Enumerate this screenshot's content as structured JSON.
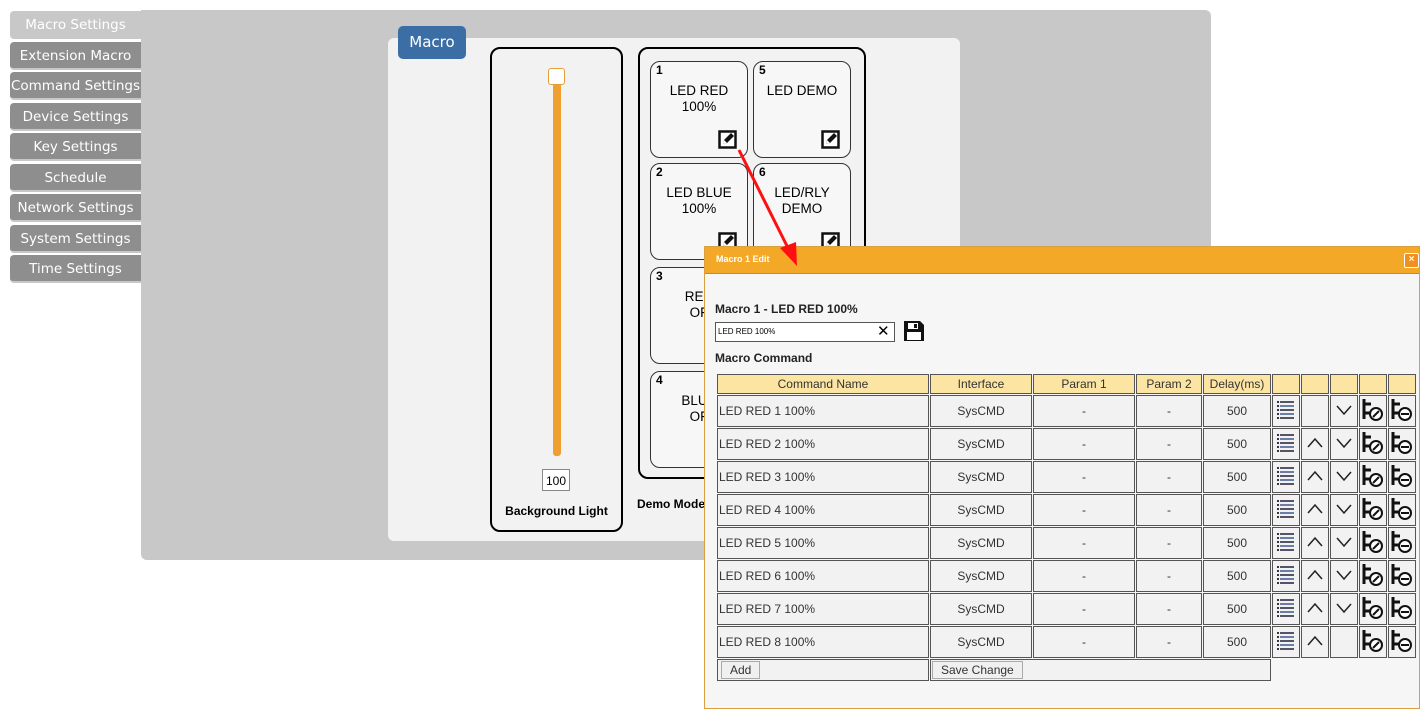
{
  "sidebar": {
    "items": [
      {
        "label": "Macro Settings",
        "active": true
      },
      {
        "label": "Extension Macro"
      },
      {
        "label": "Command Settings"
      },
      {
        "label": "Device Settings"
      },
      {
        "label": "Key Settings"
      },
      {
        "label": "Schedule"
      },
      {
        "label": "Network Settings"
      },
      {
        "label": "System Settings"
      },
      {
        "label": "Time Settings"
      }
    ]
  },
  "macro_panel": {
    "title": "Macro",
    "slider_value": "100",
    "slider_level_percent": 100,
    "bg_light_label": "Background Light",
    "demo_mode_label": "Demo Mode",
    "buttons": [
      {
        "num": "1",
        "label": "LED RED\n100%"
      },
      {
        "num": "5",
        "label": "LED DEMO"
      },
      {
        "num": "2",
        "label": "LED BLUE\n100%"
      },
      {
        "num": "6",
        "label": "LED/RLY\nDEMO"
      },
      {
        "num": "3",
        "label": "RED\nOF"
      },
      {
        "num": "4",
        "label": "BLUE\nOF"
      }
    ]
  },
  "dialog": {
    "title": "Macro 1 Edit",
    "close": "×",
    "macro_heading": "Macro 1 - LED RED 100%",
    "name_value": "LED RED 100%",
    "clear": "✕",
    "command_heading": "Macro Command",
    "columns": [
      "Command Name",
      "Interface",
      "Param 1",
      "Param 2",
      "Delay(ms)",
      "",
      "",
      "",
      "",
      ""
    ],
    "rows": [
      {
        "name": "LED RED 1 100%",
        "interface": "SysCMD",
        "p1": "-",
        "p2": "-",
        "delay": "500",
        "up": false,
        "down": true
      },
      {
        "name": "LED RED 2 100%",
        "interface": "SysCMD",
        "p1": "-",
        "p2": "-",
        "delay": "500",
        "up": true,
        "down": true
      },
      {
        "name": "LED RED 3 100%",
        "interface": "SysCMD",
        "p1": "-",
        "p2": "-",
        "delay": "500",
        "up": true,
        "down": true
      },
      {
        "name": "LED RED 4 100%",
        "interface": "SysCMD",
        "p1": "-",
        "p2": "-",
        "delay": "500",
        "up": true,
        "down": true
      },
      {
        "name": "LED RED 5 100%",
        "interface": "SysCMD",
        "p1": "-",
        "p2": "-",
        "delay": "500",
        "up": true,
        "down": true
      },
      {
        "name": "LED RED 6 100%",
        "interface": "SysCMD",
        "p1": "-",
        "p2": "-",
        "delay": "500",
        "up": true,
        "down": true
      },
      {
        "name": "LED RED 7 100%",
        "interface": "SysCMD",
        "p1": "-",
        "p2": "-",
        "delay": "500",
        "up": true,
        "down": true
      },
      {
        "name": "LED RED 8 100%",
        "interface": "SysCMD",
        "p1": "-",
        "p2": "-",
        "delay": "500",
        "up": true,
        "down": false
      }
    ],
    "add_label": "Add",
    "save_change_label": "Save Change"
  },
  "colors": {
    "accent": "#f3a828",
    "slider": "#f0a030",
    "title_blue": "#3b6ea5",
    "arrow": "#ff0000"
  }
}
